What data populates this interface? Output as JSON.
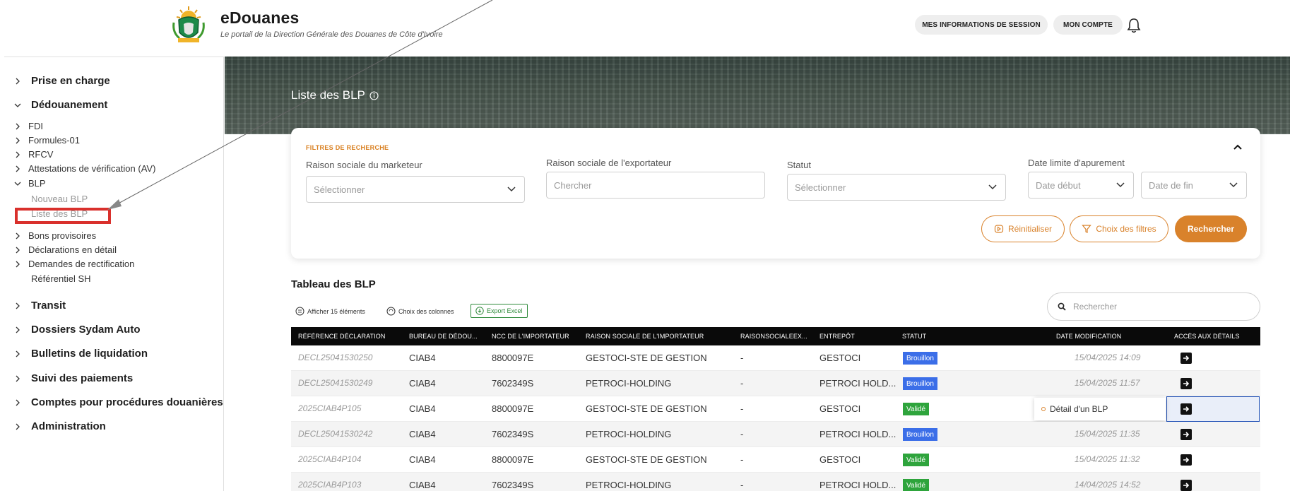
{
  "header": {
    "title": "eDouanes",
    "subtitle": "Le portail de la Direction Générale des Douanes de Côte d'Ivoire",
    "session_button": "MES INFORMATIONS DE SESSION",
    "account_button": "MON COMPTE"
  },
  "sidebar": {
    "items": [
      {
        "label": "Prise en charge"
      },
      {
        "label": "Dédouanement"
      },
      {
        "label": "Transit"
      },
      {
        "label": "Dossiers Sydam Auto"
      },
      {
        "label": "Bulletins de liquidation"
      },
      {
        "label": "Suivi des paiements"
      },
      {
        "label": "Comptes pour procédures douanières"
      },
      {
        "label": "Administration"
      }
    ],
    "sub": [
      {
        "label": "FDI"
      },
      {
        "label": "Formules-01"
      },
      {
        "label": "RFCV"
      },
      {
        "label": "Attestations de vérification (AV)"
      },
      {
        "label": "BLP"
      },
      {
        "label": "Bons provisoires"
      },
      {
        "label": "Déclarations en détail"
      },
      {
        "label": "Demandes de rectification"
      },
      {
        "label": "Référentiel SH"
      }
    ],
    "blp_children": [
      {
        "label": "Nouveau BLP"
      },
      {
        "label": "Liste des BLP"
      }
    ]
  },
  "page": {
    "title": "Liste des BLP"
  },
  "filters": {
    "section_title": "FILTRES DE RECHERCHE",
    "marketer_label": "Raison sociale du marketeur",
    "marketer_placeholder": "Sélectionner",
    "exporter_label": "Raison sociale de l'exportateur",
    "exporter_placeholder": "Chercher",
    "status_label": "Statut",
    "status_placeholder": "Sélectionner",
    "date_label": "Date limite d'apurement",
    "date_start_placeholder": "Date début",
    "date_end_placeholder": "Date de fin",
    "reset_button": "Réinitialiser",
    "choose_filters_button": "Choix des filtres",
    "search_button": "Rechercher"
  },
  "table_section": {
    "title": "Tableau des BLP",
    "show_items": "Afficher 15 éléments",
    "choose_columns": "Choix des colonnes",
    "export_excel": "Export Excel",
    "search_placeholder": "Rechercher",
    "tooltip": "Détail d'un BLP"
  },
  "table": {
    "columns": [
      "Référence déclaration",
      "Bureau de dédou...",
      "NCC de l'importateur",
      "Raison sociale de l'importateur",
      "RaisonSocialeEx...",
      "Entrepôt",
      "Statut",
      "Date modification",
      "Accès aux détails"
    ],
    "rows": [
      {
        "ref": "DECL25041530250",
        "bureau": "CIAB4",
        "ncc": "8800097E",
        "importer": "GESTOCI-STE DE GESTION",
        "exporter": "-",
        "depot": "GESTOCI",
        "status": "Brouillon",
        "date": "15/04/2025 14:09"
      },
      {
        "ref": "DECL25041530249",
        "bureau": "CIAB4",
        "ncc": "7602349S",
        "importer": "PETROCI-HOLDING",
        "exporter": "-",
        "depot": "PETROCI HOLD...",
        "status": "Brouillon",
        "date": "15/04/2025 11:57"
      },
      {
        "ref": "2025CIAB4P105",
        "bureau": "CIAB4",
        "ncc": "8800097E",
        "importer": "GESTOCI-STE DE GESTION",
        "exporter": "-",
        "depot": "GESTOCI",
        "status": "Validé",
        "date": ""
      },
      {
        "ref": "DECL25041530242",
        "bureau": "CIAB4",
        "ncc": "7602349S",
        "importer": "PETROCI-HOLDING",
        "exporter": "-",
        "depot": "PETROCI HOLD...",
        "status": "Brouillon",
        "date": "15/04/2025 11:35"
      },
      {
        "ref": "2025CIAB4P104",
        "bureau": "CIAB4",
        "ncc": "8800097E",
        "importer": "GESTOCI-STE DE GESTION",
        "exporter": "-",
        "depot": "GESTOCI",
        "status": "Validé",
        "date": "15/04/2025 11:32"
      },
      {
        "ref": "2025CIAB4P103",
        "bureau": "CIAB4",
        "ncc": "7602349S",
        "importer": "PETROCI-HOLDING",
        "exporter": "-",
        "depot": "PETROCI HOLD...",
        "status": "Validé",
        "date": "14/04/2025 14:52"
      }
    ]
  },
  "colors": {
    "accent": "#d9822b",
    "draft": "#3b6ee8",
    "valid": "#2ea43c",
    "annotation_red": "#d9302c"
  }
}
